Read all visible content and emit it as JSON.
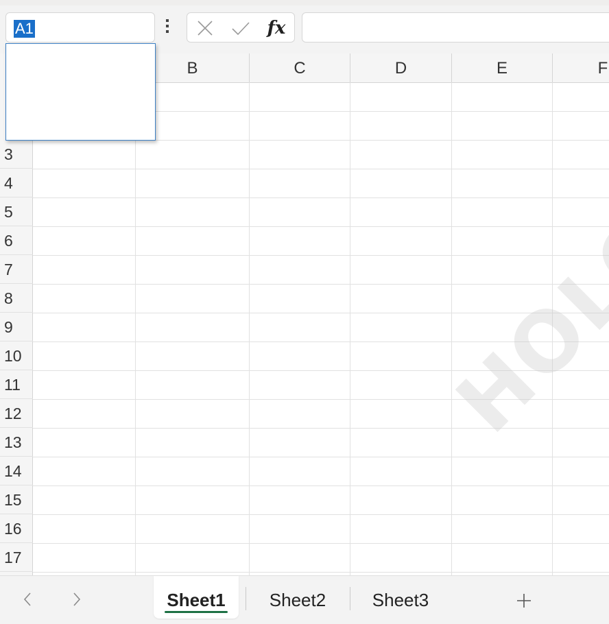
{
  "name_box": {
    "value": "A1"
  },
  "formula_bar": {
    "cancel_icon": "close-icon",
    "enter_icon": "checkmark-icon",
    "fx_label": "fx",
    "value": ""
  },
  "columns": [
    "B",
    "C",
    "D",
    "E",
    "F"
  ],
  "rows": [
    "3",
    "4",
    "5",
    "6",
    "7",
    "8",
    "9",
    "10",
    "11",
    "12",
    "13",
    "14",
    "15",
    "16",
    "17"
  ],
  "sheet_tabs": [
    {
      "label": "Sheet1",
      "active": true
    },
    {
      "label": "Sheet2",
      "active": false
    },
    {
      "label": "Sheet3",
      "active": false
    }
  ],
  "tab_nav": {
    "prev_icon": "chevron-left-icon",
    "next_icon": "chevron-right-icon"
  },
  "add_sheet_icon": "plus-icon",
  "watermark_text": "HOLOGY",
  "colors": {
    "accent": "#1e7145",
    "selection": "#1a6fc9",
    "gridline": "#e1e1e1"
  }
}
